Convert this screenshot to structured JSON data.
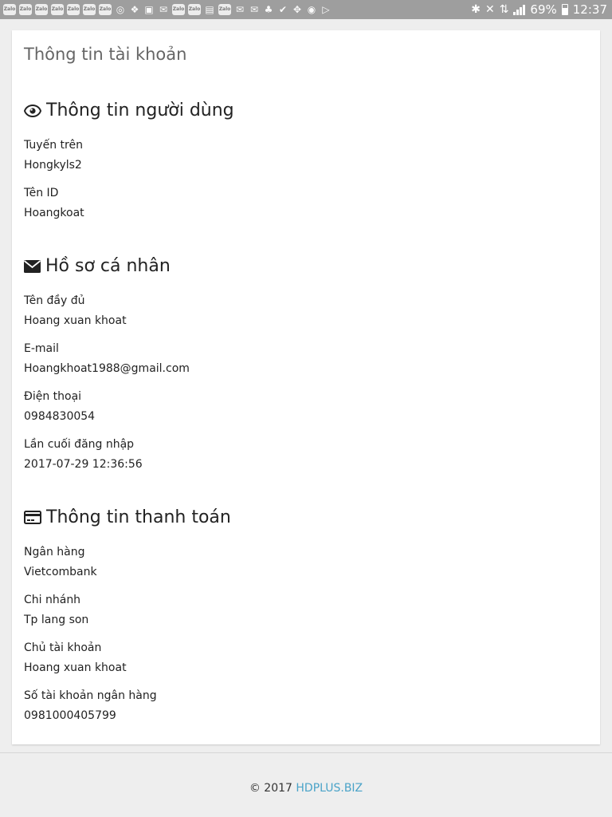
{
  "status_bar": {
    "battery": "69%",
    "time": "12:37",
    "notification_icons": [
      "zalo",
      "zalo",
      "zalo",
      "zalo",
      "zalo",
      "zalo",
      "zalo",
      "maps",
      "photo",
      "messenger",
      "gallery",
      "mail",
      "zalo",
      "zalo",
      "chat",
      "mail",
      "mail",
      "people",
      "check",
      "navigation",
      "chrome",
      "play"
    ],
    "zalo_text": "Zalo"
  },
  "page": {
    "title": "Thông tin tài khoản"
  },
  "sections": {
    "user": {
      "title": "Thông tin người dùng",
      "icon": "eye-icon",
      "fields": [
        {
          "label": "Tuyến trên",
          "value": "Hongkyls2"
        },
        {
          "label": "Tên ID",
          "value": "Hoangkoat"
        }
      ]
    },
    "profile": {
      "title": "Hồ sơ cá nhân",
      "icon": "envelope-icon",
      "fields": [
        {
          "label": "Tên đầy đủ",
          "value": "Hoang xuan khoat"
        },
        {
          "label": "E-mail",
          "value": "Hoangkhoat1988@gmail.com"
        },
        {
          "label": "Điện thoại",
          "value": "0984830054"
        },
        {
          "label": "Lần cuối đăng nhập",
          "value": "2017-07-29 12:36:56"
        }
      ]
    },
    "payment": {
      "title": "Thông tin thanh toán",
      "icon": "credit-card-icon",
      "fields": [
        {
          "label": "Ngân hàng",
          "value": "Vietcombank"
        },
        {
          "label": "Chi nhánh",
          "value": "Tp lang son"
        },
        {
          "label": "Chủ tài khoản",
          "value": "Hoang xuan khoat"
        },
        {
          "label": "Số tài khoản ngân hàng",
          "value": "0981000405799"
        }
      ]
    }
  },
  "footer": {
    "copyright": "© 2017",
    "link_text": "HDPLUS.BIZ",
    "link_color": "#4aa3c8"
  }
}
